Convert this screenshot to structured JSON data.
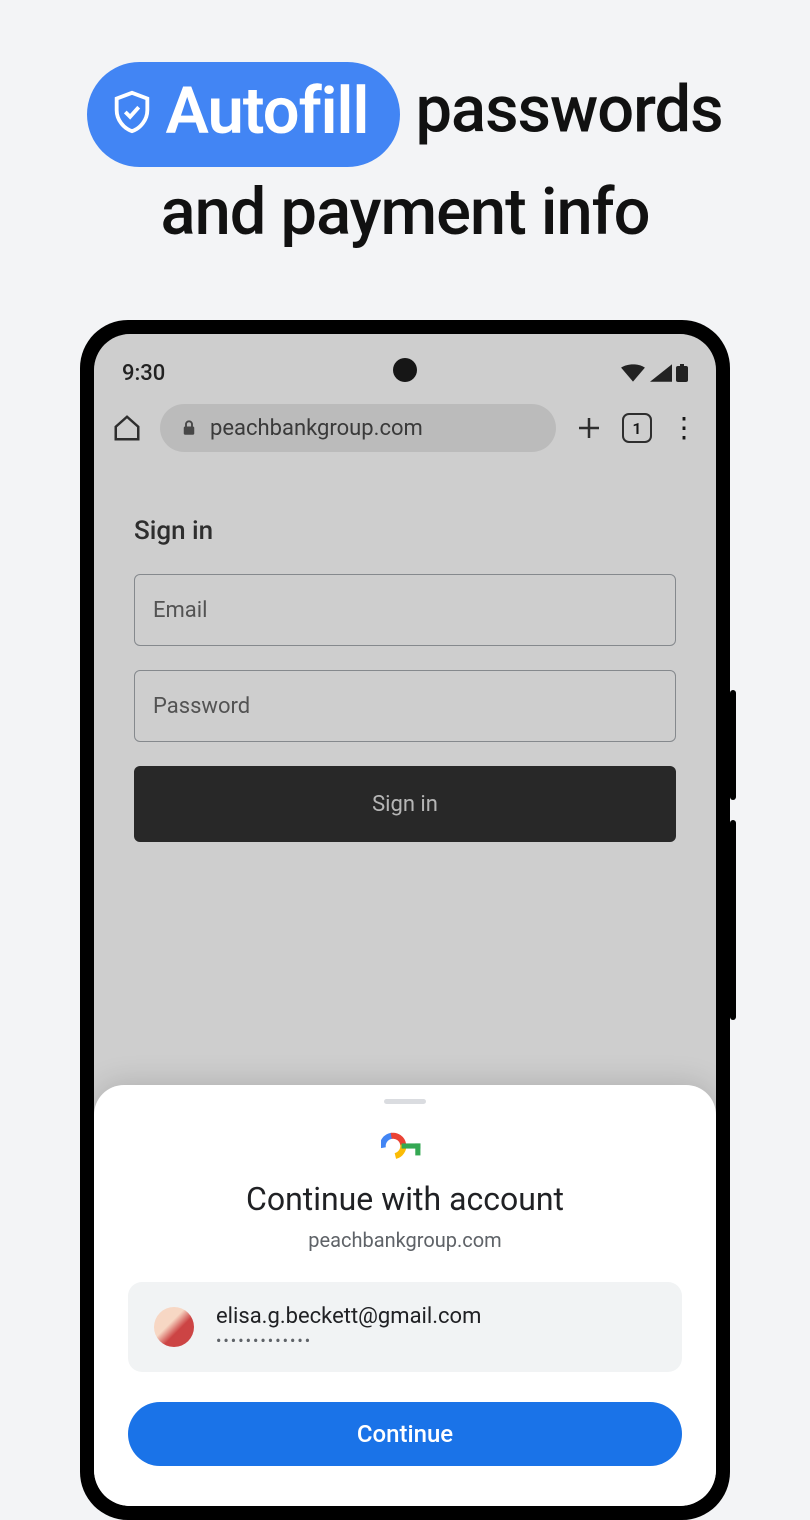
{
  "headline": {
    "pill_label": "Autofill",
    "rest_line1": " passwords",
    "line2": "and payment info"
  },
  "status": {
    "time": "9:30"
  },
  "browser": {
    "url": "peachbankgroup.com",
    "tab_count": "1"
  },
  "page": {
    "heading": "Sign in",
    "email_placeholder": "Email",
    "password_placeholder": "Password",
    "signin_label": "Sign in"
  },
  "sheet": {
    "title": "Continue with account",
    "domain": "peachbankgroup.com",
    "account_email": "elisa.g.beckett@gmail.com",
    "password_dots": "•••••••••••••",
    "continue_label": "Continue"
  }
}
